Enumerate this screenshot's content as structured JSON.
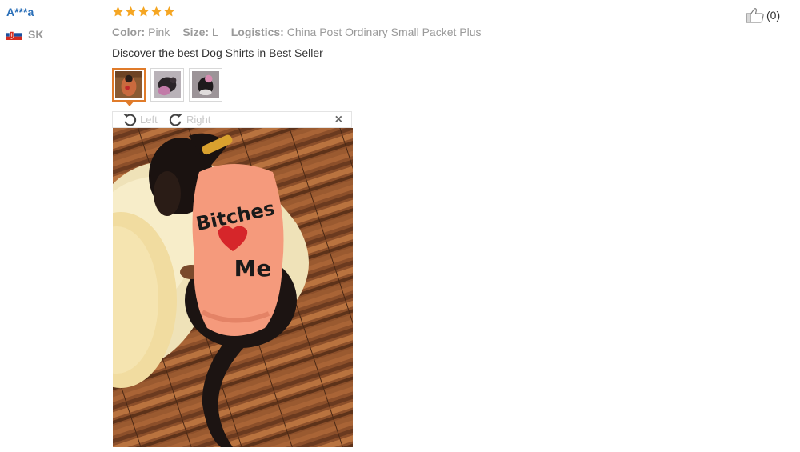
{
  "reviewer": {
    "name": "A***a",
    "country_code": "SK"
  },
  "rating": {
    "stars": 5,
    "max": 5,
    "color": "#f5a623"
  },
  "attributes": [
    {
      "label": "Color:",
      "value": "Pink"
    },
    {
      "label": "Size:",
      "value": "L"
    },
    {
      "label": "Logistics:",
      "value": "China Post Ordinary Small Packet Plus"
    }
  ],
  "review_text": "Discover the best Dog Shirts in Best Seller",
  "thumbnails": [
    {
      "icon": "dog-photo-1"
    },
    {
      "icon": "dog-photo-2"
    },
    {
      "icon": "dog-photo-3"
    }
  ],
  "viewer": {
    "rotate_left_label": "Left",
    "rotate_right_label": "Right",
    "close_label": "×"
  },
  "photo": {
    "shirt_text_top": "Bitches",
    "shirt_text_bottom": "Me"
  },
  "helpful": {
    "count_label": "(0)"
  },
  "colors": {
    "accent": "#e07b2a",
    "link": "#2a6fb8",
    "muted": "#9a9a9a"
  }
}
